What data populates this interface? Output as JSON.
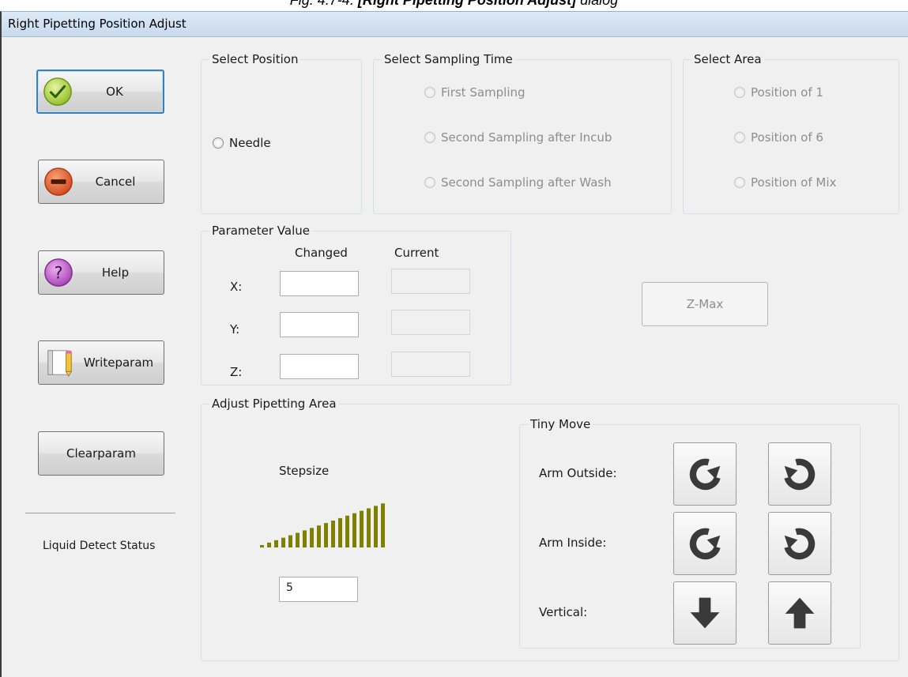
{
  "caption": {
    "prefix": "Fig. 4.7-4.",
    "bold": "[Right Pipetting Position Adjust]",
    "suffix": "dialog"
  },
  "window": {
    "title": "Right Pipetting Position Adjust"
  },
  "side_buttons": {
    "ok": "OK",
    "cancel": "Cancel",
    "help": "Help",
    "writeparam": "Writeparam",
    "clearparam": "Clearparam"
  },
  "liquid_detect_status": "Liquid Detect Status",
  "select_position": {
    "title": "Select Position",
    "options": [
      "Needle"
    ]
  },
  "select_sampling_time": {
    "title": "Select Sampling Time",
    "options": [
      "First Sampling",
      "Second Sampling after Incub",
      "Second Sampling after Wash"
    ]
  },
  "select_area": {
    "title": "Select Area",
    "options": [
      "Position of 1",
      "Position of 6",
      "Position of Mix"
    ]
  },
  "parameter_value": {
    "title": "Parameter Value",
    "changed_header": "Changed",
    "current_header": "Current",
    "rows": [
      {
        "label": "X:",
        "changed": "",
        "current": ""
      },
      {
        "label": "Y:",
        "changed": "",
        "current": ""
      },
      {
        "label": "Z:",
        "changed": "",
        "current": ""
      }
    ]
  },
  "zmax_button": "Z-Max",
  "adjust_area": {
    "title": "Adjust Pipetting Area",
    "stepsize_label": "Stepsize",
    "stepsize_value": "5",
    "level_bar_color": "#7f7f00"
  },
  "tiny_move": {
    "title": "Tiny Move",
    "rows": [
      {
        "label": "Arm Outside:",
        "left_icon": "rotate-ccw-icon",
        "right_icon": "rotate-cw-icon"
      },
      {
        "label": "Arm Inside:",
        "left_icon": "rotate-ccw-icon",
        "right_icon": "rotate-cw-icon"
      },
      {
        "label": "Vertical:",
        "left_icon": "arrow-down-icon",
        "right_icon": "arrow-up-icon"
      }
    ]
  }
}
